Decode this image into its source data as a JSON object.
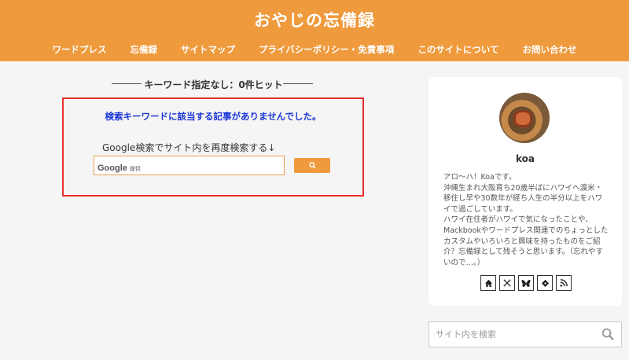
{
  "site": {
    "title": "おやじの忘備録"
  },
  "nav": [
    {
      "label": "ワードプレス"
    },
    {
      "label": "忘備録"
    },
    {
      "label": "サイトマップ"
    },
    {
      "label": "プライバシーポリシー・免責事項"
    },
    {
      "label": "このサイトについて"
    },
    {
      "label": "お問い合わせ"
    }
  ],
  "main": {
    "result_heading": "キーワード指定なし：0件ヒット",
    "not_found": "検索キーワードに該当する記事がありませんでした。",
    "research_label": "Google検索でサイト内を再度検索する↓",
    "google_logo": "Google",
    "google_provided": "提供"
  },
  "sidebar": {
    "profile": {
      "name": "koa",
      "bio_lines": [
        "アロ〜ハ！Koaです。",
        "沖縄生まれ大阪育ち20歳半ばにハワイへ渡米・",
        "移住し早や30数年が経ち人生の半分以上をハワ",
        "イで過ごしています。",
        "ハワイ在住者がハワイで気になったことや、",
        "Mackbookやワードプレス関連でのちょっとした",
        "カスタムやいろいろと興味を持ったものをご紹",
        "介？忘備録として残そうと思います。（忘れやす",
        "いので…。）"
      ],
      "social_icons": [
        "home-icon",
        "x-icon",
        "bluesky-icon",
        "feedly-icon",
        "rss-icon"
      ]
    },
    "search": {
      "placeholder": "サイト内を検索"
    }
  },
  "colors": {
    "header": "#ef9a3c",
    "notfound_text": "#1a35d6",
    "box_border": "#e8302a"
  }
}
